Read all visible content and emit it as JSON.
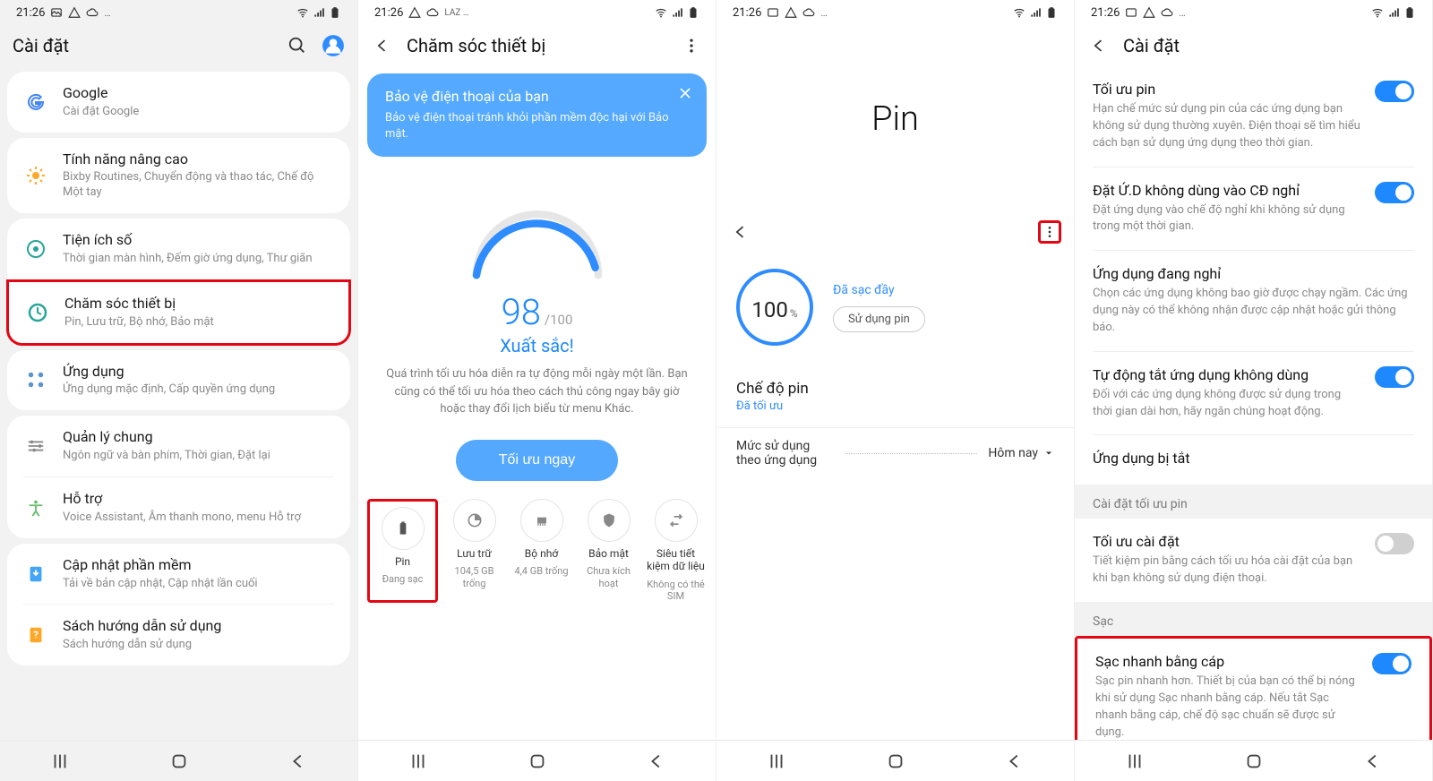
{
  "status": {
    "time": "21:26"
  },
  "nav": {
    "recent": "|||",
    "home": "○",
    "back": "‹"
  },
  "screen1": {
    "title": "Cài đặt",
    "items": [
      {
        "id": "google",
        "title": "Google",
        "sub": "Cài đặt Google"
      },
      {
        "id": "advanced",
        "title": "Tính năng nâng cao",
        "sub": "Bixby Routines, Chuyển động và thao tác, Chế độ Một tay"
      },
      {
        "id": "digital",
        "title": "Tiện ích số",
        "sub": "Thời gian màn hình, Đếm giờ ứng dụng, Thư giãn"
      },
      {
        "id": "care",
        "title": "Chăm sóc thiết bị",
        "sub": "Pin, Lưu trữ, Bộ nhớ, Bảo mật"
      },
      {
        "id": "apps",
        "title": "Ứng dụng",
        "sub": "Ứng dụng mặc định, Cấp quyền ứng dụng"
      },
      {
        "id": "general",
        "title": "Quản lý chung",
        "sub": "Ngôn ngữ và bàn phím, Thời gian, Đặt lại"
      },
      {
        "id": "access",
        "title": "Hỗ trợ",
        "sub": "Voice Assistant, Âm thanh mono, menu Hỗ trợ"
      },
      {
        "id": "update",
        "title": "Cập nhật phần mềm",
        "sub": "Tải về bản cập nhật, Cập nhật lần cuối"
      },
      {
        "id": "manual",
        "title": "Sách hướng dẫn sử dụng",
        "sub": "Sách hướng dẫn sử dụng"
      }
    ]
  },
  "screen2": {
    "title": "Chăm sóc thiết bị",
    "tip_title": "Bảo vệ điện thoại của bạn",
    "tip_body": "Bảo vệ điện thoại tránh khỏi phần mềm độc hại với Bảo mật.",
    "score": "98",
    "score_max": "/100",
    "score_label": "Xuất sắc!",
    "desc": "Quá trình tối ưu hóa diễn ra tự động mỗi ngày một lần. Bạn cũng có thể tối ưu hóa theo cách thủ công ngay bây giờ hoặc thay đổi lịch biểu từ menu Khác.",
    "optimize_btn": "Tối ưu ngay",
    "tiles": [
      {
        "name": "Pin",
        "sub": "Đang sạc"
      },
      {
        "name": "Lưu trữ",
        "sub": "104,5 GB trống"
      },
      {
        "name": "Bộ nhớ",
        "sub": "4,4 GB trống"
      },
      {
        "name": "Bảo mật",
        "sub": "Chưa kích hoạt"
      },
      {
        "name": "Siêu tiết kiệm dữ liệu",
        "sub": "Không có thẻ SIM"
      }
    ]
  },
  "screen3": {
    "big_title": "Pin",
    "percent": "100",
    "pct_sign": "%",
    "charged": "Đã sạc đầy",
    "use_battery": "Sử dụng pin",
    "mode_title": "Chế độ pin",
    "mode_status": "Đã tối ưu",
    "usage_label": "Mức sử dụng theo ứng dụng",
    "today": "Hôm nay"
  },
  "screen4": {
    "title": "Cài đặt",
    "items": [
      {
        "title": "Tối ưu pin",
        "desc": "Hạn chế mức sử dụng pin của các ứng dụng bạn không sử dụng thường xuyên. Điện thoại sẽ tìm hiểu cách bạn sử dụng ứng dụng theo thời gian.",
        "toggle": "on"
      },
      {
        "title": "Đặt Ứ.D không dùng vào CĐ nghỉ",
        "desc": "Đặt ứng dụng vào chế độ nghỉ khi không sử dụng trong một thời gian.",
        "toggle": "on"
      },
      {
        "title": "Ứng dụng đang nghỉ",
        "desc": "Chọn các ứng dụng không bao giờ được chạy ngầm. Các ứng dụng này có thể không nhận được cập nhật hoặc gửi thông báo.",
        "toggle": ""
      },
      {
        "title": "Tự động tắt ứng dụng không dùng",
        "desc": "Đối với các ứng dụng không được sử dụng trong thời gian dài hơn, hãy ngăn chúng hoạt động.",
        "toggle": "on"
      },
      {
        "title": "Ứng dụng bị tắt",
        "desc": "",
        "toggle": ""
      }
    ],
    "header_opt": "Cài đặt tối ưu pin",
    "opt_settings": {
      "title": "Tối ưu cài đặt",
      "desc": "Tiết kiệm pin bằng cách tối ưu hóa cài đặt của bạn khi bạn không sử dụng điện thoại.",
      "toggle": "off"
    },
    "header_charge": "Sạc",
    "fast_charge": {
      "title": "Sạc nhanh bằng cáp",
      "desc": "Sạc pin nhanh hơn. Thiết bị của bạn có thể bị nóng khi sử dụng Sạc nhanh bằng cáp. Nếu tắt Sạc nhanh bằng cáp, chế độ sạc chuẩn sẽ được sử dụng.",
      "toggle": "on"
    }
  }
}
